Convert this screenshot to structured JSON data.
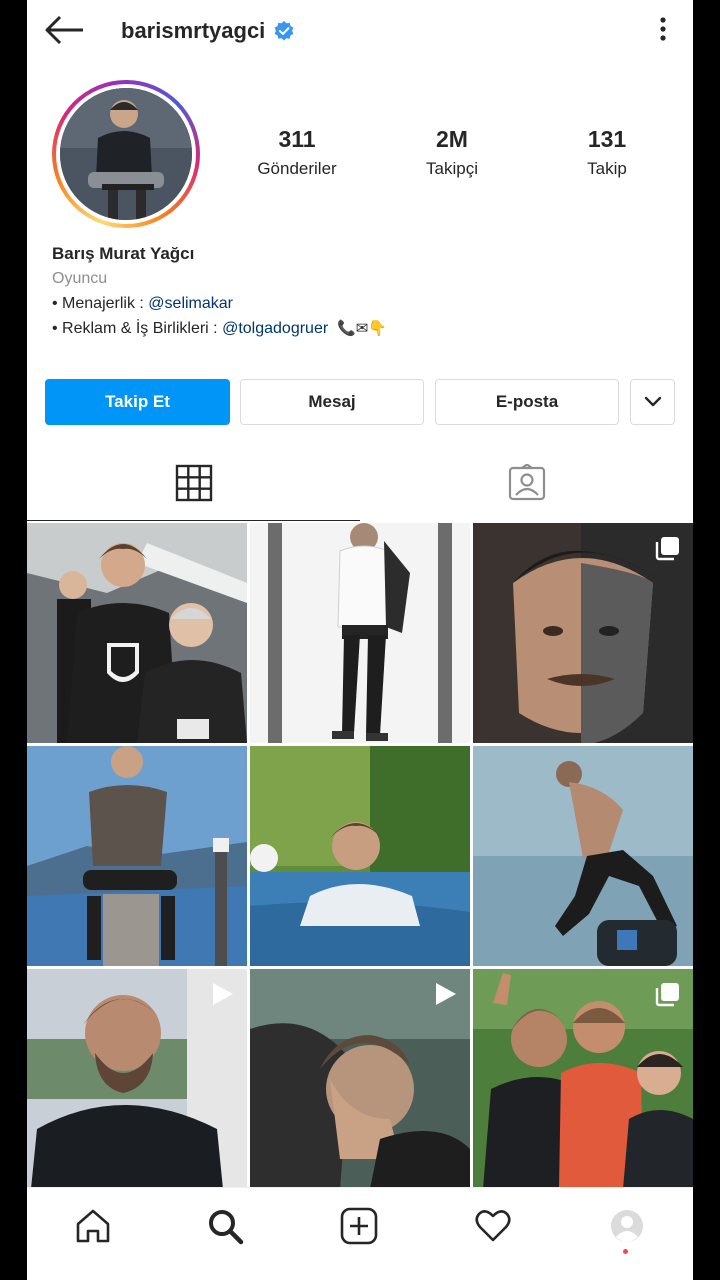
{
  "header": {
    "username": "barismrtyagci",
    "verified": true,
    "back_icon": "arrow-left-icon",
    "more_icon": "more-vertical-icon"
  },
  "profile": {
    "stats": [
      {
        "value": "311",
        "label": "Gönderiler"
      },
      {
        "value": "2M",
        "label": "Takipçi"
      },
      {
        "value": "131",
        "label": "Takip"
      }
    ],
    "name": "Barış Murat Yağcı",
    "category": "Oyuncu",
    "bio_line1_prefix": "• Menajerlik : ",
    "bio_line1_mention": "@selimakar",
    "bio_line2_prefix": "• Reklam & İş Birlikleri : ",
    "bio_line2_mention": "@tolgadogruer",
    "bio_line2_emoji": "📞✉👇"
  },
  "buttons": {
    "follow": "Takip Et",
    "message": "Mesaj",
    "email": "E-posta",
    "more_icon": "chevron-down-icon"
  },
  "tabs": [
    {
      "name": "grid",
      "icon": "grid-icon",
      "active": true
    },
    {
      "name": "tagged",
      "icon": "tagged-person-icon",
      "active": false
    }
  ],
  "posts": [
    {
      "type": "photo",
      "badge": ""
    },
    {
      "type": "photo",
      "badge": ""
    },
    {
      "type": "carousel",
      "badge": "carousel-icon"
    },
    {
      "type": "photo",
      "badge": ""
    },
    {
      "type": "photo",
      "badge": ""
    },
    {
      "type": "photo",
      "badge": ""
    },
    {
      "type": "video",
      "badge": "play-icon"
    },
    {
      "type": "video",
      "badge": "play-icon"
    },
    {
      "type": "carousel",
      "badge": "carousel-icon"
    }
  ],
  "bottom_nav": [
    {
      "name": "home",
      "icon": "home-icon"
    },
    {
      "name": "search",
      "icon": "search-icon"
    },
    {
      "name": "new-post",
      "icon": "plus-square-icon"
    },
    {
      "name": "activity",
      "icon": "heart-icon"
    },
    {
      "name": "profile",
      "icon": "profile-avatar-icon"
    }
  ],
  "colors": {
    "accent": "#0095f6",
    "text": "#262626",
    "secondary": "#8e8e8e",
    "mention": "#00376b",
    "border": "#dbdbdb",
    "notification_dot": "#ed4956"
  }
}
